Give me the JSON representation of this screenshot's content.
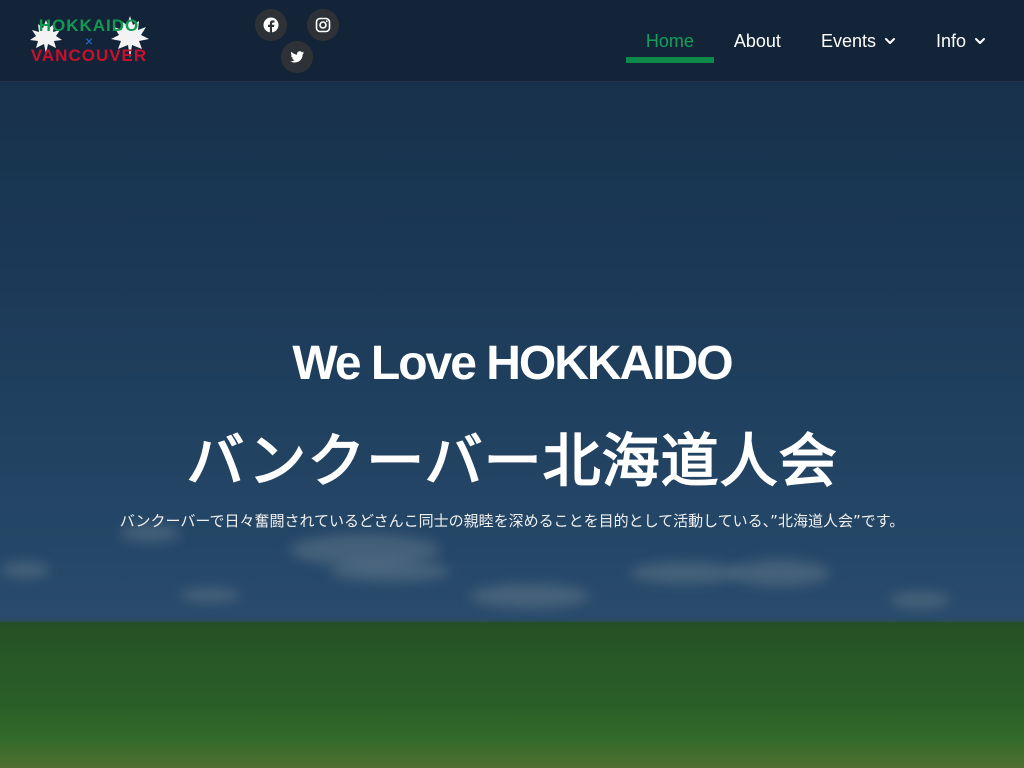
{
  "header": {
    "logo": {
      "line1": "HOKKAIDO",
      "cross": "×",
      "line2": "VANCOUVER",
      "colors": {
        "green": "#129a53",
        "red": "#c8102e",
        "blue": "#2a6fdb"
      }
    },
    "social": [
      {
        "name": "facebook",
        "icon": "facebook-icon"
      },
      {
        "name": "instagram",
        "icon": "instagram-icon"
      },
      {
        "name": "twitter",
        "icon": "twitter-icon"
      }
    ],
    "nav": [
      {
        "label": "Home",
        "active": true,
        "dropdown": false
      },
      {
        "label": "About",
        "active": false,
        "dropdown": false
      },
      {
        "label": "Events",
        "active": false,
        "dropdown": true
      },
      {
        "label": "Info",
        "active": false,
        "dropdown": true
      }
    ],
    "accent": "#129a53"
  },
  "hero": {
    "title": "We Love HOKKAIDO",
    "subtitle": "バンクーバー北海道人会",
    "description": "バンクーバーで日々奮闘されているどさんこ同士の親睦を深めることを目的として活動している、”北海道人会”です。"
  }
}
